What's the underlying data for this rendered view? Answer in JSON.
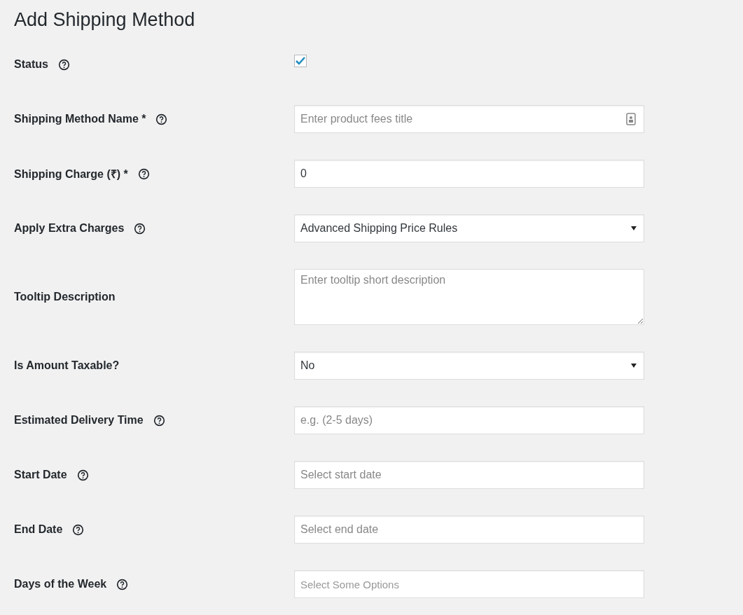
{
  "title": "Add Shipping Method",
  "fields": [
    {
      "label": "Status",
      "help": true,
      "kind": "checkbox",
      "checked": true
    },
    {
      "label": "Shipping Method Name *",
      "help": true,
      "kind": "text-icon",
      "placeholder": "Enter product fees title"
    },
    {
      "label": "Shipping Charge (₹) *",
      "help": true,
      "kind": "text",
      "value": "0"
    },
    {
      "label": "Apply Extra Charges",
      "help": true,
      "kind": "select",
      "value": "Advanced Shipping Price Rules"
    },
    {
      "label": "Tooltip Description",
      "help": false,
      "kind": "textarea",
      "placeholder": "Enter tooltip short description"
    },
    {
      "label": "Is Amount Taxable?",
      "help": false,
      "kind": "select",
      "value": "No"
    },
    {
      "label": "Estimated Delivery Time",
      "help": true,
      "kind": "text",
      "placeholder": "e.g. (2-5 days)"
    },
    {
      "label": "Start Date",
      "help": true,
      "kind": "text",
      "placeholder": "Select start date"
    },
    {
      "label": "End Date",
      "help": true,
      "kind": "text",
      "placeholder": "Select end date"
    },
    {
      "label": "Days of the Week",
      "help": true,
      "kind": "multiselect",
      "placeholder": "Select Some Options"
    }
  ]
}
